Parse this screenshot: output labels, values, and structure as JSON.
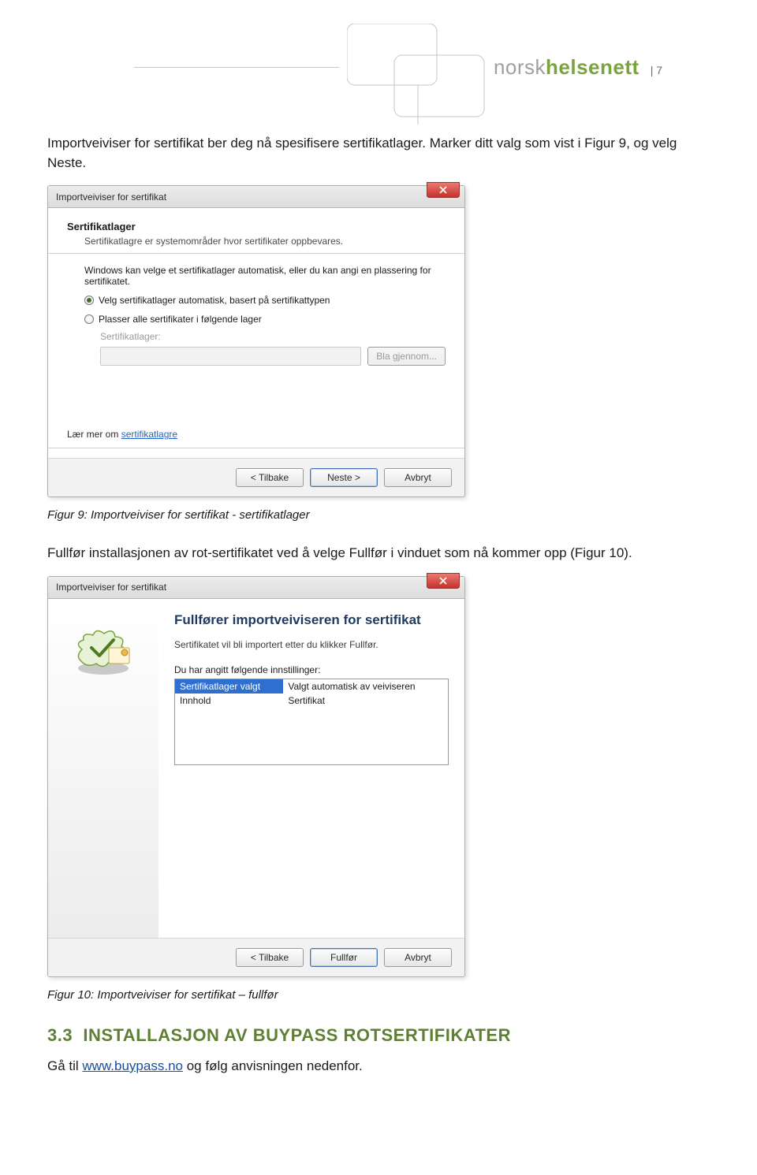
{
  "header": {
    "brand_light": "norsk",
    "brand_bold": "helsenett",
    "page_num": "| 7"
  },
  "para1": "Importveiviser for sertifikat ber deg nå spesifisere sertifikatlager. Marker ditt valg som vist i Figur 9, og velg Neste.",
  "dialog1": {
    "title": "Importveiviser for sertifikat",
    "heading": "Sertifikatlager",
    "sub": "Sertifikatlagre er systemområder hvor sertifikater oppbevares.",
    "explain": "Windows kan velge et sertifikatlager automatisk, eller du kan angi en plassering for sertifikatet.",
    "radio_auto": "Velg sertifikatlager automatisk, basert på sertifikattypen",
    "radio_place": "Plasser alle sertifikater i følgende lager",
    "field_label": "Sertifikatlager:",
    "browse": "Bla gjennom...",
    "learn": "Lær mer om ",
    "learn_link": "sertifikatlagre",
    "back": "< Tilbake",
    "next": "Neste >",
    "cancel": "Avbryt"
  },
  "caption1": "Figur 9: Importveiviser for sertifikat - sertifikatlager",
  "para2": "Fullfør installasjonen av rot-sertifikatet ved å velge Fullfør i vinduet som nå kommer opp (Figur 10).",
  "dialog2": {
    "title": "Importveiviser for sertifikat",
    "big_title": "Fullfører importveiviseren for sertifikat",
    "info": "Sertifikatet vil bli importert etter du klikker Fullfør.",
    "list_label": "Du har angitt følgende innstillinger:",
    "rows": [
      {
        "k": "Sertifikatlager valgt",
        "v": "Valgt automatisk av veiviseren"
      },
      {
        "k": "Innhold",
        "v": "Sertifikat"
      }
    ],
    "back": "< Tilbake",
    "finish": "Fullfør",
    "cancel": "Avbryt"
  },
  "caption2": "Figur 10: Importveiviser for sertifikat – fullfør",
  "section": {
    "num": "3.3",
    "title": "INSTALLASJON AV BUYPASS ROTSERTIFIKATER"
  },
  "para3_a": "Gå til ",
  "para3_link": "www.buypass.no",
  "para3_b": " og følg anvisningen nedenfor."
}
